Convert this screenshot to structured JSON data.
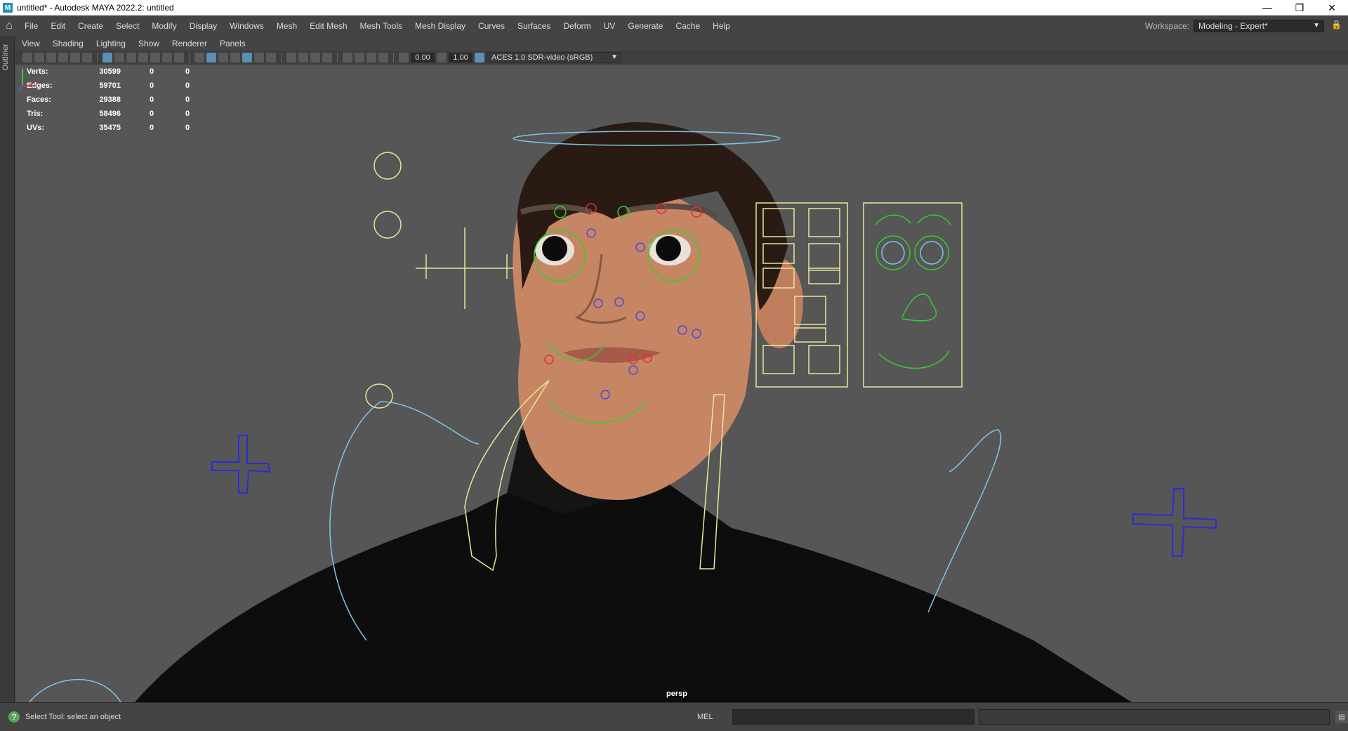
{
  "window": {
    "title": "untitled* - Autodesk MAYA 2022.2: untitled",
    "icon": "M",
    "minimize": "—",
    "maximize": "❐",
    "close": "✕"
  },
  "menubar": {
    "items": [
      "File",
      "Edit",
      "Create",
      "Select",
      "Modify",
      "Display",
      "Windows",
      "Mesh",
      "Edit Mesh",
      "Mesh Tools",
      "Mesh Display",
      "Curves",
      "Surfaces",
      "Deform",
      "UV",
      "Generate",
      "Cache",
      "Help"
    ],
    "workspace_label": "Workspace:",
    "workspace_value": "Modeling - Expert*"
  },
  "sidebar": {
    "outliner_label": "Outliner"
  },
  "panel_menu": {
    "items": [
      "View",
      "Shading",
      "Lighting",
      "Show",
      "Renderer",
      "Panels"
    ]
  },
  "panel_toolbar": {
    "exposure": "0.00",
    "gamma": "1.00",
    "color_space": "ACES 1.0 SDR-video (sRGB)"
  },
  "hud": {
    "rows": [
      {
        "label": "Verts:",
        "v1": "30599",
        "v2": "0",
        "v3": "0"
      },
      {
        "label": "Edges:",
        "v1": "59701",
        "v2": "0",
        "v3": "0"
      },
      {
        "label": "Faces:",
        "v1": "29388",
        "v2": "0",
        "v3": "0"
      },
      {
        "label": "Tris:",
        "v1": "58496",
        "v2": "0",
        "v3": "0"
      },
      {
        "label": "UVs:",
        "v1": "35475",
        "v2": "0",
        "v3": "0"
      }
    ]
  },
  "viewport": {
    "camera_label": "persp"
  },
  "statusbar": {
    "help_text": "Select Tool: select an object",
    "mel_label": "MEL"
  },
  "colors": {
    "viewport_bg": "#565656",
    "control_yellow": "#e8e898",
    "control_cyan": "#7ec6e6",
    "control_blue": "#2b2bd8",
    "control_red": "#e03030",
    "control_green": "#30d030"
  }
}
